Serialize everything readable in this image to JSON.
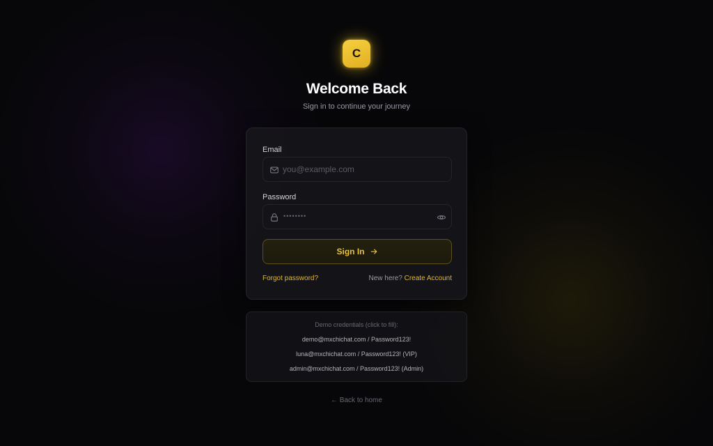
{
  "brand": {
    "logo_letter": "C",
    "accent": "#e8c23a"
  },
  "header": {
    "title": "Welcome Back",
    "subtitle": "Sign in to continue your journey"
  },
  "form": {
    "email_label": "Email",
    "email_placeholder": "you@example.com",
    "email_value": "",
    "password_label": "Password",
    "password_mask": "••••••••",
    "signin_label": "Sign In",
    "forgot_label": "Forgot password?",
    "new_here_text": "New here?",
    "create_account_label": "Create Account"
  },
  "demo": {
    "title": "Demo credentials (click to fill):",
    "credentials": [
      "demo@mxchichat.com / Password123!",
      "luna@mxchichat.com / Password123! (VIP)",
      "admin@mxchichat.com / Password123! (Admin)"
    ]
  },
  "footer": {
    "back_label": "← Back to home"
  },
  "icons": {
    "email_field": "mail-icon",
    "password_field": "lock-icon",
    "password_toggle": "eye-icon",
    "signin_button": "arrow-right-icon"
  }
}
